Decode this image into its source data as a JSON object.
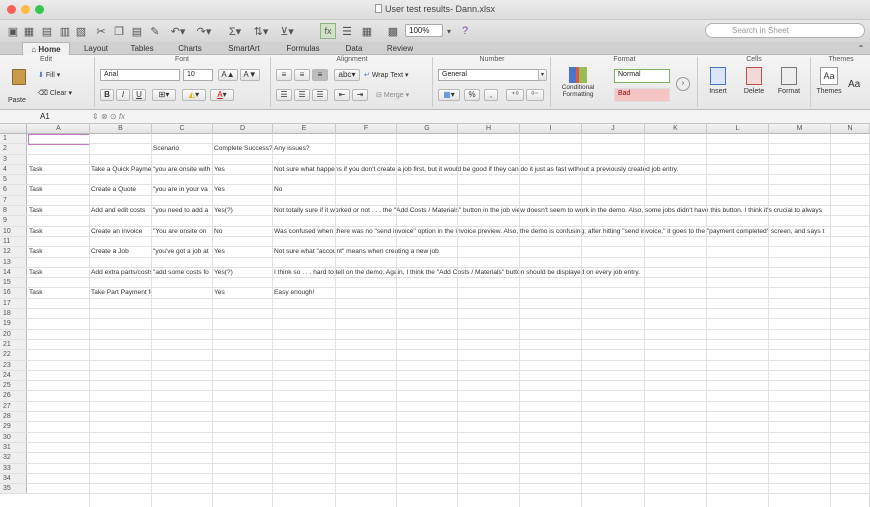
{
  "window": {
    "title": "User test results- Dann.xlsx",
    "colors": {
      "close": "#fc605c",
      "minimize": "#fdbc40",
      "zoom": "#34c84a"
    }
  },
  "toolbar": {
    "zoom_value": "100%",
    "search_placeholder": "Search in Sheet"
  },
  "tabs": [
    "Home",
    "Layout",
    "Tables",
    "Charts",
    "SmartArt",
    "Formulas",
    "Data",
    "Review"
  ],
  "ribbon": {
    "groups": {
      "edit": "Edit",
      "font": "Font",
      "alignment": "Alignment",
      "number": "Number",
      "format": "Format",
      "cells": "Cells",
      "themes": "Themes"
    },
    "paste": "Paste",
    "fill": "Fill",
    "clear": "Clear",
    "font_name": "Arial",
    "font_size": "10",
    "font_grow": "A▲",
    "font_shrink": "A▼",
    "bold": "B",
    "italic": "I",
    "underline": "U",
    "abc": "abc",
    "wrap_text": "Wrap Text",
    "merge": "Merge",
    "number_format": "General",
    "percent": "%",
    "thousands": ",",
    "conditional_formatting": "Conditional Formatting",
    "style_normal": "Normal",
    "style_bad": "Bad",
    "insert": "Insert",
    "delete": "Delete",
    "format": "Format",
    "themes": "Themes",
    "themes_aa": "Aa"
  },
  "formula_bar": {
    "cell_ref": "A1",
    "fx": "fx",
    "formula": ""
  },
  "columns": [
    "A",
    "B",
    "C",
    "D",
    "E",
    "F",
    "G",
    "H",
    "I",
    "J",
    "K",
    "L",
    "M",
    "N"
  ],
  "rows": [
    {
      "n": "1",
      "cells": []
    },
    {
      "n": "2",
      "cells": [
        {
          "col": "C",
          "text": "Scenario"
        },
        {
          "col": "D",
          "text": "Complete Success?"
        },
        {
          "col": "E",
          "text": "Any issues?"
        }
      ]
    },
    {
      "n": "3",
      "cells": []
    },
    {
      "n": "4",
      "cells": [
        {
          "col": "A",
          "text": "Task"
        },
        {
          "col": "B",
          "text": "Take a Quick Payment"
        },
        {
          "col": "C",
          "text": "\"you are onsite with"
        },
        {
          "col": "D",
          "text": "Yes"
        },
        {
          "col": "E",
          "text": "Not sure what happens if you don't create a job first, but it would be good if they can do it just as fast without a previously created job entry.",
          "overflow": true
        }
      ]
    },
    {
      "n": "5",
      "cells": []
    },
    {
      "n": "6",
      "cells": [
        {
          "col": "A",
          "text": "Task"
        },
        {
          "col": "B",
          "text": "Create a Quote"
        },
        {
          "col": "C",
          "text": "\"you are in your va"
        },
        {
          "col": "D",
          "text": "Yes"
        },
        {
          "col": "E",
          "text": "No"
        }
      ]
    },
    {
      "n": "7",
      "cells": []
    },
    {
      "n": "8",
      "cells": [
        {
          "col": "A",
          "text": "Task"
        },
        {
          "col": "B",
          "text": "Add and edit costs"
        },
        {
          "col": "C",
          "text": "\"you need to add a"
        },
        {
          "col": "D",
          "text": "Yes(?)"
        },
        {
          "col": "E",
          "text": "Not totally sure if it worked or not . . . the \"Add Costs / Materials\" button in the job view doesn't seem to work in the demo. Also, some jobs didn't have this button. I think it's crucial to always",
          "overflow": true
        }
      ]
    },
    {
      "n": "9",
      "cells": []
    },
    {
      "n": "10",
      "cells": [
        {
          "col": "A",
          "text": "Task"
        },
        {
          "col": "B",
          "text": "Create an invoice"
        },
        {
          "col": "C",
          "text": "\"You are onsite on"
        },
        {
          "col": "D",
          "text": "No"
        },
        {
          "col": "E",
          "text": "Was confused when there was no \"send invoice\" option in the invoice preview. Also, the demo is confusing; after hitting \"send invoice,\" it goes to the \"payment completed\" screen, and says t",
          "overflow": true
        }
      ]
    },
    {
      "n": "11",
      "cells": []
    },
    {
      "n": "12",
      "cells": [
        {
          "col": "A",
          "text": "Task"
        },
        {
          "col": "B",
          "text": "Create a Job"
        },
        {
          "col": "C",
          "text": "\"you've got a job at"
        },
        {
          "col": "D",
          "text": "Yes"
        },
        {
          "col": "E",
          "text": "Not sure what \"account\" means when creating a new job",
          "overflow": true
        }
      ]
    },
    {
      "n": "13",
      "cells": []
    },
    {
      "n": "14",
      "cells": [
        {
          "col": "A",
          "text": "Task"
        },
        {
          "col": "B",
          "text": "Add extra parts/costs"
        },
        {
          "col": "C",
          "text": "\"add some costs fo"
        },
        {
          "col": "D",
          "text": "Yes(?)"
        },
        {
          "col": "E",
          "text": "I think so . . . hard to tell on the demo. Again, I think the \"Add Costs / Materials\" button should be displayed on every job entry.",
          "overflow": true
        }
      ]
    },
    {
      "n": "15",
      "cells": []
    },
    {
      "n": "16",
      "cells": [
        {
          "col": "A",
          "text": "Task"
        },
        {
          "col": "B",
          "text": "Take Part Payment for a Job"
        },
        {
          "col": "D",
          "text": "Yes"
        },
        {
          "col": "E",
          "text": "Easy enough!"
        }
      ]
    },
    {
      "n": "17",
      "cells": []
    },
    {
      "n": "18",
      "cells": []
    },
    {
      "n": "19",
      "cells": []
    },
    {
      "n": "20",
      "cells": []
    },
    {
      "n": "21",
      "cells": []
    },
    {
      "n": "22",
      "cells": []
    },
    {
      "n": "23",
      "cells": []
    },
    {
      "n": "24",
      "cells": []
    },
    {
      "n": "25",
      "cells": []
    },
    {
      "n": "26",
      "cells": []
    },
    {
      "n": "27",
      "cells": []
    },
    {
      "n": "28",
      "cells": []
    },
    {
      "n": "29",
      "cells": []
    },
    {
      "n": "30",
      "cells": []
    },
    {
      "n": "31",
      "cells": []
    },
    {
      "n": "32",
      "cells": []
    },
    {
      "n": "33",
      "cells": []
    },
    {
      "n": "34",
      "cells": []
    },
    {
      "n": "35",
      "cells": []
    }
  ]
}
